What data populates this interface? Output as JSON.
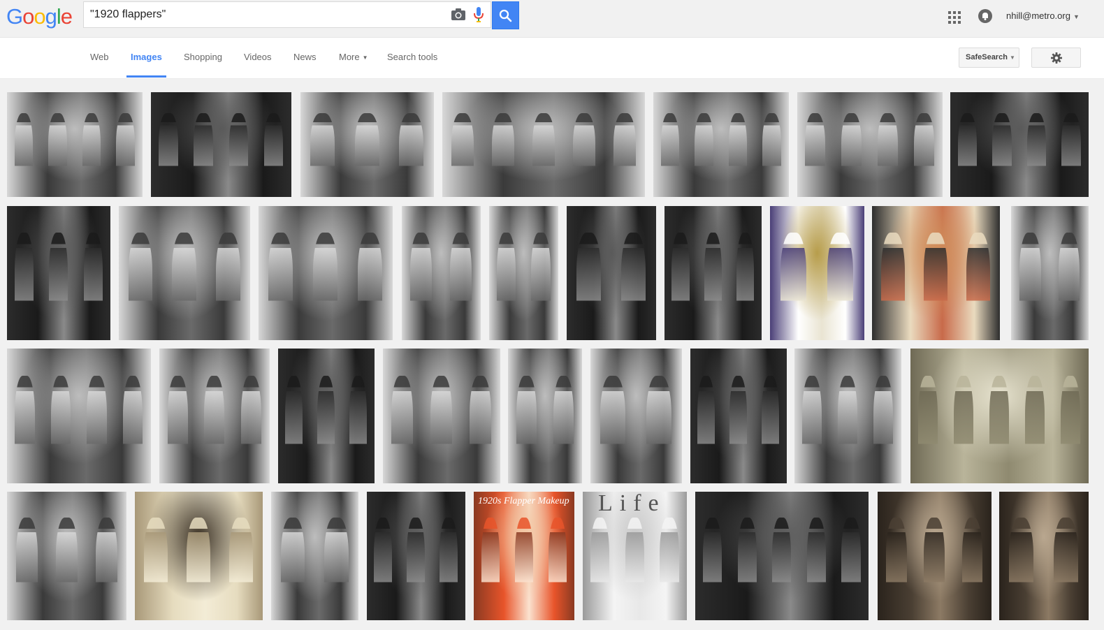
{
  "header": {
    "logo_letters": [
      {
        "ch": "G",
        "color": "#4285f4"
      },
      {
        "ch": "o",
        "color": "#ea4335"
      },
      {
        "ch": "o",
        "color": "#fbbc05"
      },
      {
        "ch": "g",
        "color": "#4285f4"
      },
      {
        "ch": "l",
        "color": "#34a853"
      },
      {
        "ch": "e",
        "color": "#ea4335"
      }
    ],
    "search_query": "\"1920 flappers\"",
    "search_button_icon": "magnifier-icon",
    "camera_icon": "camera-icon",
    "mic_icon": "microphone-icon",
    "apps_icon": "apps-grid-icon",
    "notification_icon": "notification-bell-icon",
    "account_email": "nhill@metro.org"
  },
  "nav": {
    "tabs": [
      {
        "label": "Web",
        "active": false
      },
      {
        "label": "Images",
        "active": true
      },
      {
        "label": "Shopping",
        "active": false
      },
      {
        "label": "Videos",
        "active": false
      },
      {
        "label": "News",
        "active": false
      },
      {
        "label": "More",
        "active": false
      },
      {
        "label": "Search tools",
        "active": false
      }
    ],
    "safesearch_label": "SafeSearch",
    "settings_icon": "gear-icon"
  },
  "results": {
    "accent_color": "#4285f4",
    "thumb_texts": {
      "makeup": "1920s Flapper Makeup",
      "life": "Life"
    },
    "rows": [
      [
        "bw",
        "bw-dark",
        "bw",
        "bw",
        "bw",
        "bw",
        "bw-dark"
      ],
      [
        "bw-dark",
        "bw",
        "bw",
        "bw",
        "bw",
        "bw-dark",
        "bw-dark",
        "color-illustration",
        "color-illustration-beige",
        "bw"
      ],
      [
        "bw",
        "bw",
        "bw-dark",
        "bw",
        "bw",
        "bw",
        "bw-dark",
        "bw",
        "sepia-green"
      ],
      [
        "bw",
        "sepia",
        "bw",
        "bw-dark",
        "color-orange",
        "bw-light",
        "bw-dark",
        "sepia-dark",
        "sepia-dark"
      ]
    ]
  }
}
